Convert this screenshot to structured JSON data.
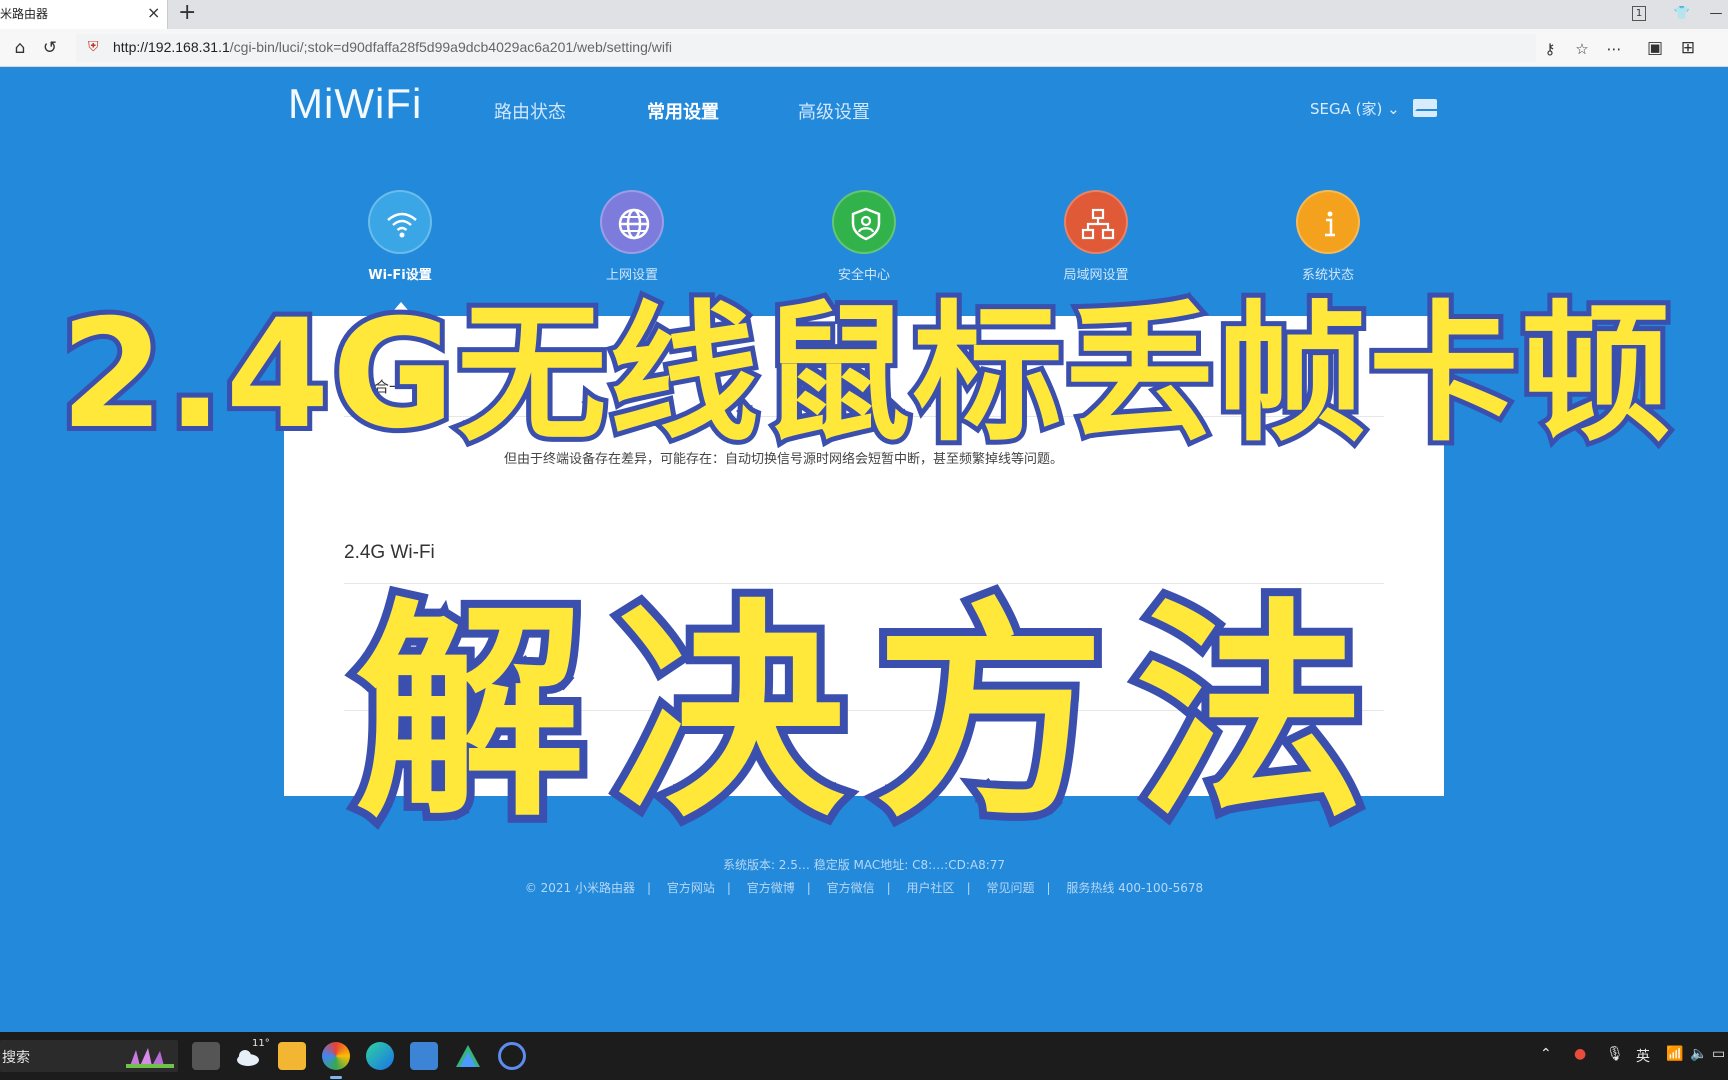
{
  "browser": {
    "tab_title": "米路由器",
    "tab_close": "×",
    "new_tab": "+",
    "url_host": "http://192.168.31.1",
    "url_path": "/cgi-bin/luci/;stok=d90dfaffa28f5d99a9dcb4029ac6a201/web/setting/wifi",
    "tab_count": "1"
  },
  "router": {
    "logo": "MiWiFi",
    "nav": [
      "路由状态",
      "常用设置",
      "高级设置"
    ],
    "nav_active": 1,
    "user": "SEGA (家)",
    "functions": [
      {
        "label": "Wi-Fi设置",
        "color": "#3aa6e6",
        "icon": "wifi-icon"
      },
      {
        "label": "上网设置",
        "color": "#7d7cdc",
        "icon": "globe-icon"
      },
      {
        "label": "安全中心",
        "color": "#32b24a",
        "icon": "shield-icon"
      },
      {
        "label": "局域网设置",
        "color": "#e05a37",
        "icon": "lan-icon"
      },
      {
        "label": "系统状态",
        "color": "#f4a21e",
        "icon": "info-icon"
      }
    ]
  },
  "panel": {
    "section_title": "双频合一",
    "description_line2": "但由于终端设备存在差异，可能存在：自动切换信号源时网络会短暂中断，甚至频繁掉线等问题。",
    "wifi_title": "2.4G Wi-Fi"
  },
  "footer": {
    "version_line": "系统版本: 2.5… 稳定版  MAC地址: C8:…:CD:A8:77",
    "links": [
      "© 2021 小米路由器",
      "官方网站",
      "官方微博",
      "官方微信",
      "用户社区",
      "常见问题",
      "服务热线 400-100-5678"
    ]
  },
  "overlay": {
    "line1": "2.4G无线鼠标丢帧卡顿",
    "line2": "解决方法"
  },
  "taskbar": {
    "search_label": "搜索",
    "temperature": "11°",
    "ime": "英"
  },
  "colors": {
    "router_bg": "#2389db",
    "overlay_fill": "#ffe83a",
    "overlay_stroke": "#3a4fae"
  }
}
